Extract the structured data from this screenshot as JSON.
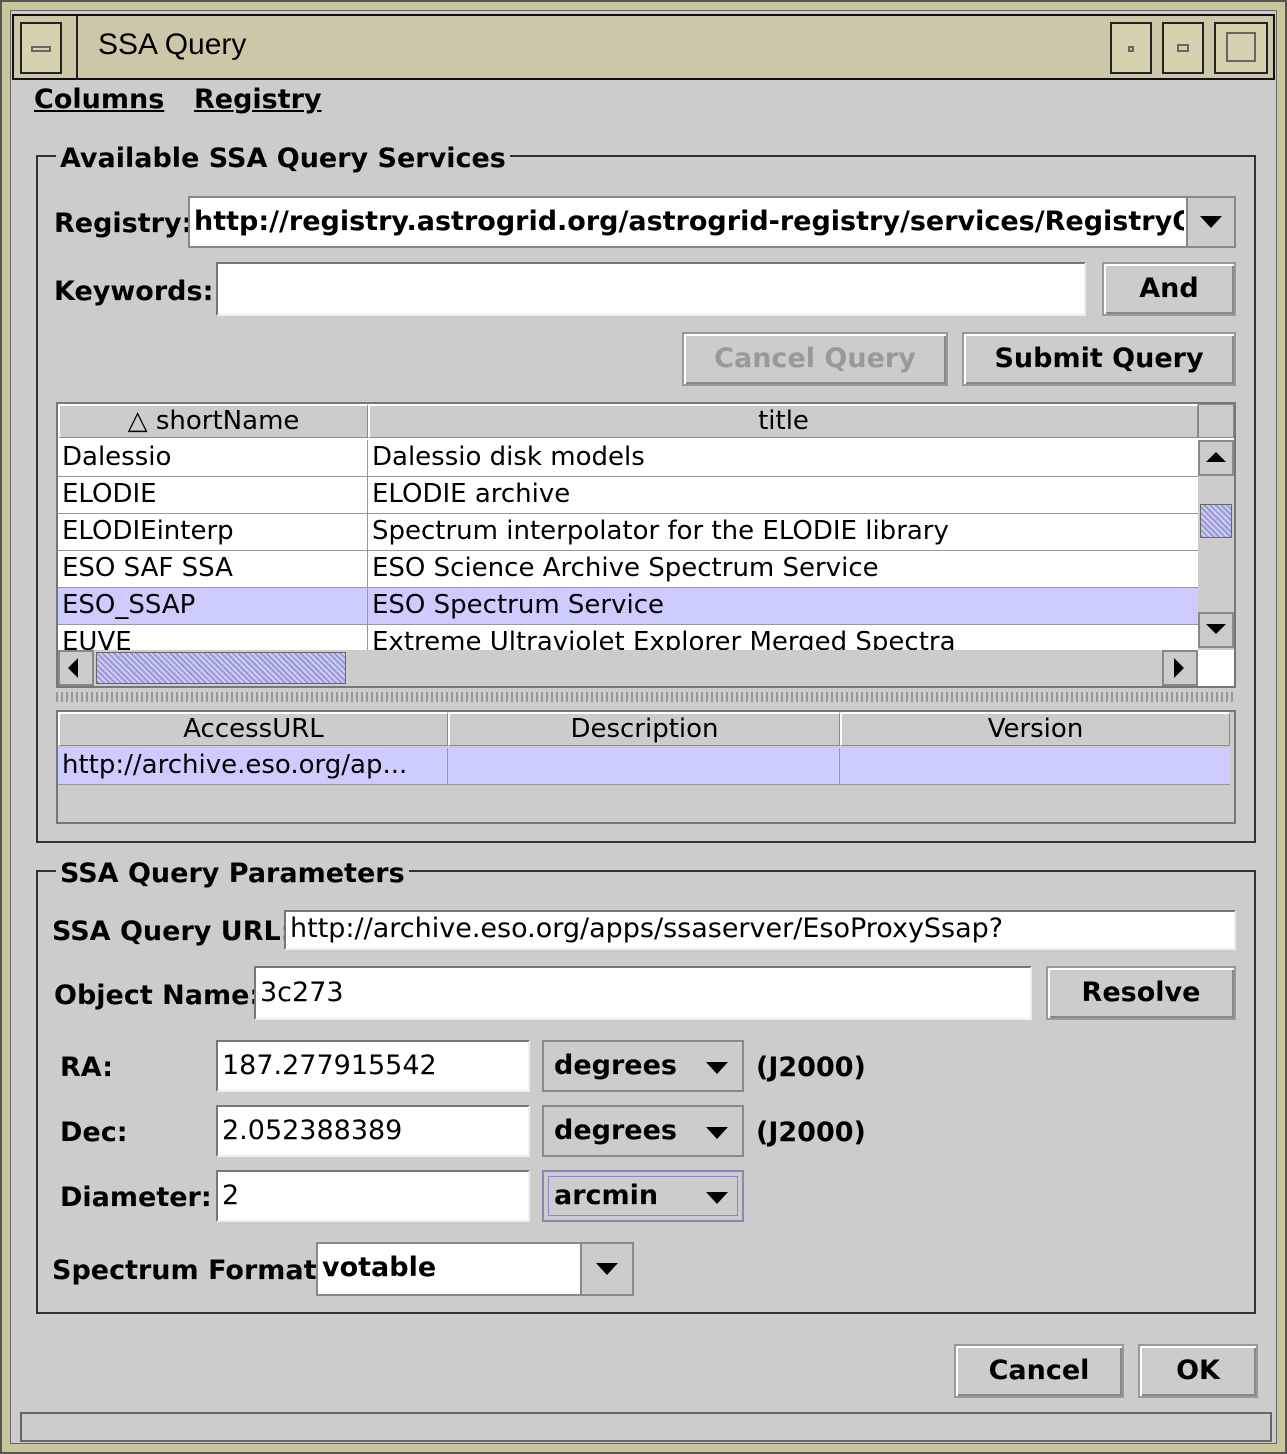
{
  "window": {
    "title": "SSA Query"
  },
  "menu": {
    "columns": "Columns",
    "registry": "Registry"
  },
  "services": {
    "group_title": "Available SSA Query Services",
    "registry_label": "Registry:",
    "registry_value": "http://registry.astrogrid.org/astrogrid-registry/services/RegistryQu",
    "keywords_label": "Keywords:",
    "keywords_value": "",
    "and_button": "And",
    "cancel_query_button": "Cancel Query",
    "submit_query_button": "Submit Query",
    "table": {
      "headers": [
        "△  shortName",
        "title"
      ],
      "rows": [
        {
          "shortName": "Dalessio",
          "title": "Dalessio disk models",
          "selected": false
        },
        {
          "shortName": "ELODIE",
          "title": "ELODIE archive",
          "selected": false
        },
        {
          "shortName": "ELODIEinterp",
          "title": "Spectrum interpolator for the ELODIE library",
          "selected": false
        },
        {
          "shortName": "ESO SAF SSA",
          "title": "ESO Science Archive Spectrum Service",
          "selected": false
        },
        {
          "shortName": "ESO_SSAP",
          "title": "ESO Spectrum Service",
          "selected": true
        },
        {
          "shortName": "EUVE",
          "title": "Extreme Ultraviolet Explorer Merged Spectra",
          "selected": false
        }
      ]
    },
    "detail_table": {
      "headers": [
        "AccessURL",
        "Description",
        "Version"
      ],
      "rows": [
        {
          "accessurl": "http://archive.eso.org/ap...",
          "description": "",
          "version": ""
        }
      ]
    }
  },
  "params": {
    "group_title": "SSA Query Parameters",
    "query_url_label": "SSA Query URL:",
    "query_url_value": "http://archive.eso.org/apps/ssaserver/EsoProxySsap?",
    "object_name_label": "Object Name:",
    "object_name_value": "3c273",
    "resolve_button": "Resolve",
    "ra_label": "RA:",
    "ra_value": "187.277915542",
    "ra_units": "degrees",
    "ra_epoch": "(J2000)",
    "dec_label": "Dec:",
    "dec_value": "2.052388389",
    "dec_units": "degrees",
    "dec_epoch": "(J2000)",
    "diameter_label": "Diameter:",
    "diameter_value": "2",
    "diameter_units": "arcmin",
    "format_label": "Spectrum Format:",
    "format_value": "votable"
  },
  "footer": {
    "cancel_button": "Cancel",
    "ok_button": "OK"
  },
  "colors": {
    "frame": "#c8c69a",
    "selection": "#ccccff",
    "background": "#cccccc"
  },
  "icons": [
    "window-menu-icon",
    "minimize-icon",
    "maximize-icon",
    "sort-ascending-icon",
    "dropdown-arrow-icon"
  ]
}
